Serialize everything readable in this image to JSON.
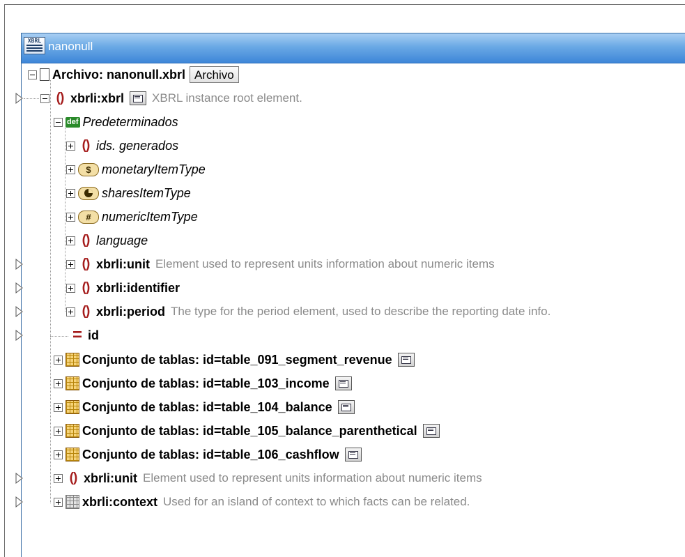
{
  "window": {
    "title": "nanonull"
  },
  "tree": {
    "file": {
      "label": "Archivo: nanonull.xbrl",
      "button": "Archivo"
    },
    "root": {
      "label": "xbrli:xbrl",
      "desc": "XBRL instance root element."
    },
    "defaults": {
      "badge": "def",
      "label": "Predeterminados"
    },
    "defaults_children": [
      {
        "icon": "braces",
        "label": "ids. generados"
      },
      {
        "icon": "$",
        "label": "monetaryItemType"
      },
      {
        "icon": "pie",
        "label": "sharesItemType"
      },
      {
        "icon": "#",
        "label": "numericItemType"
      },
      {
        "icon": "braces",
        "label": "language"
      },
      {
        "icon": "braces",
        "label": "xbrli:unit",
        "desc": "Element used to represent units information about numeric items"
      },
      {
        "icon": "braces",
        "label": "xbrli:identifier"
      },
      {
        "icon": "braces",
        "label": "xbrli:period",
        "desc": "The type for the period element, used to describe the reporting date info."
      }
    ],
    "attribute": {
      "label": "id"
    },
    "table_sets": [
      "Conjunto de tablas: id=table_091_segment_revenue",
      "Conjunto de tablas: id=table_103_income",
      "Conjunto de tablas: id=table_104_balance",
      "Conjunto de tablas: id=table_105_balance_parenthetical",
      "Conjunto de tablas: id=table_106_cashflow"
    ],
    "unit": {
      "label": "xbrli:unit",
      "desc": "Element used to represent units information about numeric items"
    },
    "context": {
      "label": "xbrli:context",
      "desc": "Used for an island of context to which facts can be related."
    }
  },
  "colors": {
    "titlebar": "#3e86d8",
    "element_icon": "#a51d1d",
    "description": "#8a8a8a"
  }
}
